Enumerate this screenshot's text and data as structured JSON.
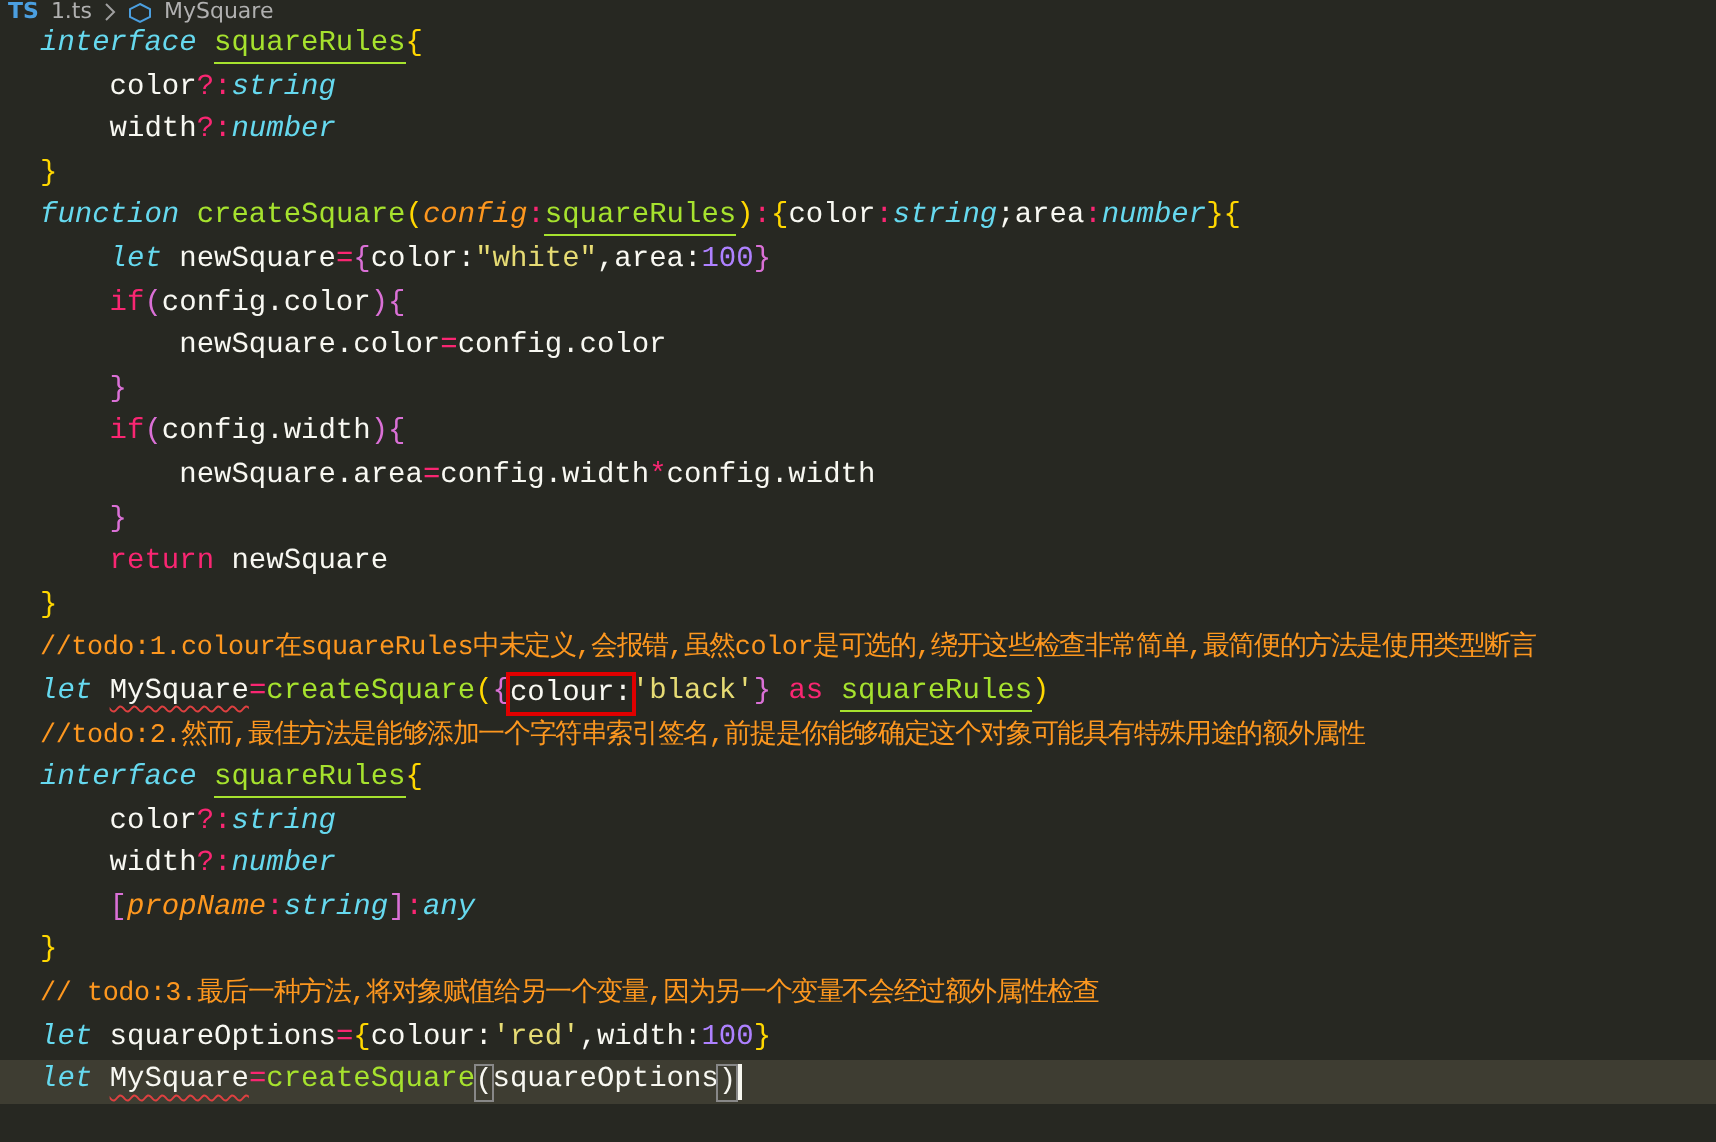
{
  "breadcrumb": {
    "file_badge": "TS",
    "file": "1.ts",
    "symbol": "MySquare"
  },
  "lines": [
    {
      "active": false,
      "tokens": [
        {
          "kind": "keyword",
          "text": "interface "
        },
        {
          "kind": "typename",
          "text": "squareRules"
        },
        {
          "kind": "brace",
          "text": "{"
        }
      ]
    },
    {
      "active": false,
      "tokens": [
        {
          "kind": "plain",
          "text": "    color"
        },
        {
          "kind": "op",
          "text": "?:"
        },
        {
          "kind": "type",
          "text": "string"
        }
      ]
    },
    {
      "active": false,
      "tokens": [
        {
          "kind": "plain",
          "text": "    width"
        },
        {
          "kind": "op",
          "text": "?:"
        },
        {
          "kind": "type",
          "text": "number"
        }
      ]
    },
    {
      "active": false,
      "tokens": [
        {
          "kind": "brace",
          "text": "}"
        }
      ]
    },
    {
      "active": false,
      "tokens": [
        {
          "kind": "keyword",
          "text": "function "
        },
        {
          "kind": "fn",
          "text": "createSquare"
        },
        {
          "kind": "brace",
          "text": "("
        },
        {
          "kind": "param",
          "text": "config"
        },
        {
          "kind": "op",
          "text": ":"
        },
        {
          "kind": "typename",
          "text": "squareRules"
        },
        {
          "kind": "brace",
          "text": ")"
        },
        {
          "kind": "op",
          "text": ":"
        },
        {
          "kind": "brace",
          "text": "{"
        },
        {
          "kind": "plain",
          "text": "color"
        },
        {
          "kind": "op",
          "text": ":"
        },
        {
          "kind": "type",
          "text": "string"
        },
        {
          "kind": "plain",
          "text": ";area"
        },
        {
          "kind": "op",
          "text": ":"
        },
        {
          "kind": "type",
          "text": "number"
        },
        {
          "kind": "brace",
          "text": "}"
        },
        {
          "kind": "brace",
          "text": "{"
        }
      ]
    },
    {
      "active": false,
      "tokens": [
        {
          "kind": "keyword",
          "text": "    let"
        },
        {
          "kind": "plain",
          "text": " newSquare"
        },
        {
          "kind": "op",
          "text": "="
        },
        {
          "kind": "brace2",
          "text": "{"
        },
        {
          "kind": "plain",
          "text": "color:"
        },
        {
          "kind": "string",
          "text": "\"white\""
        },
        {
          "kind": "plain",
          "text": ",area:"
        },
        {
          "kind": "number",
          "text": "100"
        },
        {
          "kind": "brace2",
          "text": "}"
        }
      ]
    },
    {
      "active": false,
      "tokens": [
        {
          "kind": "control",
          "text": "    if"
        },
        {
          "kind": "brace2",
          "text": "("
        },
        {
          "kind": "plain",
          "text": "config.color"
        },
        {
          "kind": "brace2",
          "text": ")"
        },
        {
          "kind": "brace2",
          "text": "{"
        }
      ]
    },
    {
      "active": false,
      "tokens": [
        {
          "kind": "plain",
          "text": "        newSquare.color"
        },
        {
          "kind": "op",
          "text": "="
        },
        {
          "kind": "plain",
          "text": "config.color"
        }
      ]
    },
    {
      "active": false,
      "tokens": [
        {
          "kind": "brace2",
          "text": "    }"
        }
      ]
    },
    {
      "active": false,
      "tokens": [
        {
          "kind": "control",
          "text": "    if"
        },
        {
          "kind": "brace2",
          "text": "("
        },
        {
          "kind": "plain",
          "text": "config.width"
        },
        {
          "kind": "brace2",
          "text": ")"
        },
        {
          "kind": "brace2",
          "text": "{"
        }
      ]
    },
    {
      "active": false,
      "tokens": [
        {
          "kind": "plain",
          "text": "        newSquare.area"
        },
        {
          "kind": "op",
          "text": "="
        },
        {
          "kind": "plain",
          "text": "config.width"
        },
        {
          "kind": "op",
          "text": "*"
        },
        {
          "kind": "plain",
          "text": "config.width"
        }
      ]
    },
    {
      "active": false,
      "tokens": [
        {
          "kind": "brace2",
          "text": "    }"
        }
      ]
    },
    {
      "active": false,
      "tokens": [
        {
          "kind": "control",
          "text": "    return"
        },
        {
          "kind": "plain",
          "text": " newSquare"
        }
      ]
    },
    {
      "active": false,
      "tokens": [
        {
          "kind": "brace",
          "text": "}"
        }
      ]
    },
    {
      "active": false,
      "tokens": [
        {
          "kind": "comment",
          "text": "//todo:1.colour在squareRules中未定义,会报错,虽然color是可选的,绕开这些检查非常简单,最简便的方法是使用类型断言"
        }
      ]
    },
    {
      "active": false,
      "tokens": [
        {
          "kind": "keyword",
          "text": "let "
        },
        {
          "kind": "error",
          "text": "MySquare"
        },
        {
          "kind": "op",
          "text": "="
        },
        {
          "kind": "fn",
          "text": "createSquare"
        },
        {
          "kind": "brace",
          "text": "("
        },
        {
          "kind": "brace2",
          "text": "{"
        },
        {
          "kind": "boxed",
          "text": "colour:"
        },
        {
          "kind": "string",
          "text": "'black'"
        },
        {
          "kind": "brace2",
          "text": "} "
        },
        {
          "kind": "control",
          "text": "as "
        },
        {
          "kind": "typename",
          "text": "squareRules"
        },
        {
          "kind": "brace",
          "text": ")"
        }
      ]
    },
    {
      "active": false,
      "tokens": [
        {
          "kind": "comment",
          "text": "//todo:2.然而,最佳方法是能够添加一个字符串索引签名,前提是你能够确定这个对象可能具有特殊用途的额外属性"
        }
      ]
    },
    {
      "active": false,
      "tokens": [
        {
          "kind": "keyword",
          "text": "interface "
        },
        {
          "kind": "typename",
          "text": "squareRules"
        },
        {
          "kind": "brace",
          "text": "{"
        }
      ]
    },
    {
      "active": false,
      "tokens": [
        {
          "kind": "plain",
          "text": "    color"
        },
        {
          "kind": "op",
          "text": "?:"
        },
        {
          "kind": "type",
          "text": "string"
        }
      ]
    },
    {
      "active": false,
      "tokens": [
        {
          "kind": "plain",
          "text": "    width"
        },
        {
          "kind": "op",
          "text": "?:"
        },
        {
          "kind": "type",
          "text": "number"
        }
      ]
    },
    {
      "active": false,
      "tokens": [
        {
          "kind": "brace2",
          "text": "    ["
        },
        {
          "kind": "param",
          "text": "propName"
        },
        {
          "kind": "op",
          "text": ":"
        },
        {
          "kind": "type",
          "text": "string"
        },
        {
          "kind": "brace2",
          "text": "]"
        },
        {
          "kind": "op",
          "text": ":"
        },
        {
          "kind": "type",
          "text": "any"
        }
      ]
    },
    {
      "active": false,
      "tokens": [
        {
          "kind": "brace",
          "text": "}"
        }
      ]
    },
    {
      "active": false,
      "tokens": [
        {
          "kind": "comment",
          "text": "// todo:3.最后一种方法,将对象赋值给另一个变量,因为另一个变量不会经过额外属性检查"
        }
      ]
    },
    {
      "active": false,
      "tokens": [
        {
          "kind": "keyword",
          "text": "let"
        },
        {
          "kind": "plain",
          "text": " squareOptions"
        },
        {
          "kind": "op",
          "text": "="
        },
        {
          "kind": "brace",
          "text": "{"
        },
        {
          "kind": "plain",
          "text": "colour:"
        },
        {
          "kind": "string",
          "text": "'red'"
        },
        {
          "kind": "plain",
          "text": ",width:"
        },
        {
          "kind": "number",
          "text": "100"
        },
        {
          "kind": "brace",
          "text": "}"
        }
      ]
    },
    {
      "active": true,
      "tokens": [
        {
          "kind": "keyword",
          "text": "let "
        },
        {
          "kind": "error",
          "text": "MySquare"
        },
        {
          "kind": "op",
          "text": "="
        },
        {
          "kind": "fn",
          "text": "createSquare"
        },
        {
          "kind": "match",
          "text": "("
        },
        {
          "kind": "plain",
          "text": "squareOptions"
        },
        {
          "kind": "match",
          "text": ")"
        }
      ]
    }
  ]
}
